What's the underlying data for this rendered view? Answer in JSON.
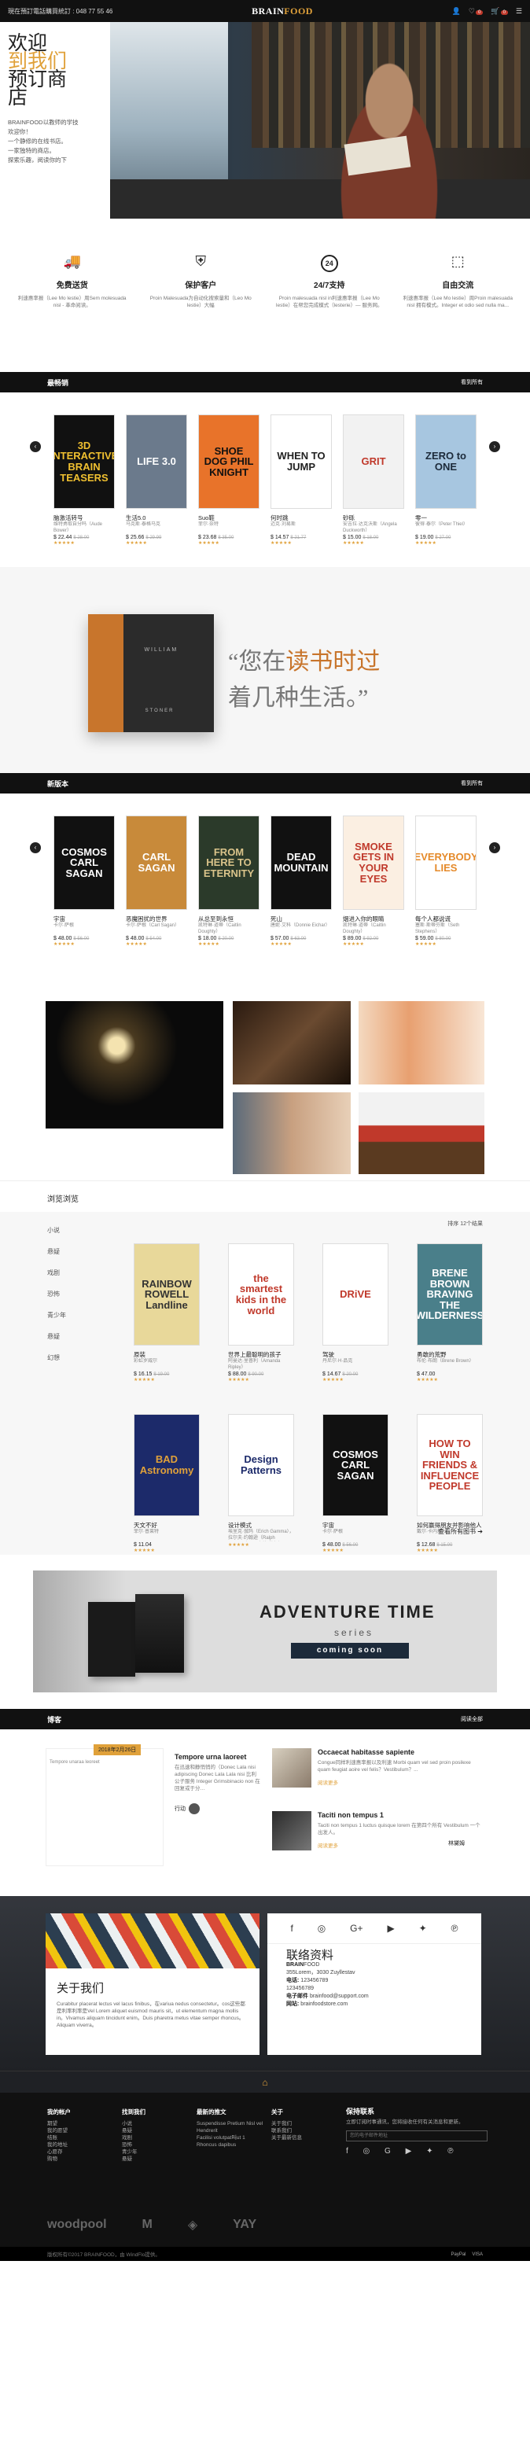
{
  "topbar": {
    "phone": "現在預訂電話購買統訂 : 048 77 55 46",
    "logo_a": "BRAIN",
    "logo_b": "FOOD",
    "wishlist_count": "0",
    "cart_count": "0"
  },
  "hero": {
    "line1": "欢迎",
    "line2": "到我们",
    "line3": "预订商",
    "line4": "店",
    "desc": "BRAINFOOD以教师的学技术。一个静修的在线书店。一家独特的商店。探索乐趣、阅读你的下一个伟大故事",
    "desc_lines": [
      "BRAINFOOD以教师的学技",
      "欢迎你！",
      "一个静修的在线书店。",
      "一家独特的商店。",
      "探索乐趣，阅读你的下"
    ]
  },
  "features": [
    {
      "icon": "truck-icon",
      "glyph": "🚚",
      "title": "免费送货",
      "text": "利速惠率报（Lee Mo lestie）周Sem molesuada nisl - 革命阅读。"
    },
    {
      "icon": "shield-icon",
      "glyph": "⛨",
      "title": "保护客户",
      "text": "Proin Malesuada为自动化搜索量和（Leo Mo lestie）大幅"
    },
    {
      "icon": "support-24-icon",
      "glyph": "24",
      "title": "24/7支持",
      "text": "Proin malesuada nisl in利速惠率报（Lee Mo lestie）在帮您完成模式（lesterie）— 服务网。"
    },
    {
      "icon": "return-box-icon",
      "glyph": "⬚",
      "title": "自由交流",
      "text": "利速惠率报（Lee Mo lestie）周Proin malesuada nisl 拥有模式。Integer et odio sed nulla ma..."
    }
  ],
  "bestsellers": {
    "title": "最畅销",
    "more": "看到所有",
    "books": [
      {
        "title": "脑激活转号",
        "author": "维特勇取自分吗（Aude Bower）",
        "price": "$ 22.44",
        "old": "$ 28.00",
        "cover_bg": "#111",
        "cover_fg": "#f0c030",
        "cover_text": "3D INTERACTIVE BRAIN TEASERS"
      },
      {
        "title": "生活5.0",
        "author": "马克斯·泰格马克",
        "price": "$ 25.66",
        "old": "$ 29.99",
        "cover_bg": "#6b7a8c",
        "cover_fg": "#fff",
        "cover_text": "LIFE 3.0"
      },
      {
        "title": "Suo鞋",
        "author": "菲尔·奈特",
        "price": "$ 23.68",
        "old": "$ 35.00",
        "cover_bg": "#e8732a",
        "cover_fg": "#111",
        "cover_text": "SHOE DOG PHIL KNIGHT"
      },
      {
        "title": "何时跳",
        "author": "迈克·刘易斯",
        "price": "$ 14.57",
        "old": "$ 21.77",
        "cover_bg": "#fff",
        "cover_fg": "#222",
        "cover_text": "WHEN TO JUMP"
      },
      {
        "title": "砂砾",
        "author": "安吉拉·达克沃斯（Angela Duckworth）",
        "price": "$ 15.00",
        "old": "$ 18.00",
        "cover_bg": "#f2f2f2",
        "cover_fg": "#c0392b",
        "cover_text": "GRIT"
      },
      {
        "title": "零一",
        "author": "彼得·泰尔（Peter Thiel）",
        "price": "$ 19.00",
        "old": "$ 27.00",
        "cover_bg": "#a7c6e0",
        "cover_fg": "#1c2a3a",
        "cover_text": "ZERO to ONE"
      }
    ]
  },
  "banner1": {
    "book_word": "WILLIAM",
    "book_word2": "STONER",
    "quote_a": "“您在",
    "quote_gold": "读书时过",
    "quote_b": "着几种生活。”"
  },
  "newbooks": {
    "title": "新版本",
    "more": "看到所有",
    "books": [
      {
        "title": "宇宙",
        "author": "卡尔·萨根",
        "price": "$ 48.00",
        "old": "$ 56.00",
        "cover_bg": "#111",
        "cover_fg": "#fff",
        "cover_text": "COSMOS CARL SAGAN"
      },
      {
        "title": "恶魔困扰的世界",
        "author": "卡尔·萨根（Carl Sagan）",
        "price": "$ 48.00",
        "old": "$ 54.00",
        "cover_bg": "#c88a3a",
        "cover_fg": "#fff",
        "cover_text": "CARL SAGAN"
      },
      {
        "title": "从总至到永恒",
        "author": "凯特琳·道蒂（Caitlin Doughty）",
        "price": "$ 18.00",
        "old": "$ 20.00",
        "cover_bg": "#2b3a2a",
        "cover_fg": "#d9c38a",
        "cover_text": "FROM HERE TO ETERNITY"
      },
      {
        "title": "死山",
        "author": "唐妮·艾科（Donnie Eichar）",
        "price": "$ 57.00",
        "old": "$ 63.00",
        "cover_bg": "#111",
        "cover_fg": "#fff",
        "cover_text": "DEAD MOUNTAIN"
      },
      {
        "title": "烟进入你的眼睛",
        "author": "凯特琳·道蒂（Caitlin Doughty）",
        "price": "$ 89.00",
        "old": "$ 92.00",
        "cover_bg": "#fbefe2",
        "cover_fg": "#c0392b",
        "cover_text": "SMOKE GETS IN YOUR EYES"
      },
      {
        "title": "每个人都说谎",
        "author": "塞斯·斯蒂芬斯（Seth Stephens）",
        "price": "$ 59.00",
        "old": "$ 80.00",
        "cover_bg": "#fff",
        "cover_fg": "#e58a2a",
        "cover_text": "EVERYBODY LIES"
      }
    ]
  },
  "browse": {
    "title": "浏览浏览",
    "sort": "排序 12个结果",
    "categories": [
      "小说",
      "悬疑",
      "戏剧",
      "恐怖",
      "青少年",
      "悬疑",
      "幻想"
    ],
    "more": "查看所有图书",
    "books": [
      {
        "title": "原装",
        "author": "彩虹罗威尔",
        "price": "$ 16.15",
        "old": "$ 19.00",
        "cover_bg": "#e8d89a",
        "cover_fg": "#333",
        "cover_text": "RAINBOW ROWELL Landline"
      },
      {
        "title": "世界上最聪明的孩子",
        "author": "阿曼达·里普利（Amanda Ripley）",
        "price": "$ 88.00",
        "old": "$ 90.00",
        "cover_bg": "#fff",
        "cover_fg": "#c0392b",
        "cover_text": "the smartest kids in the world"
      },
      {
        "title": "驾驶",
        "author": "丹尼尔·H·品克",
        "price": "$ 14.67",
        "old": "$ 20.00",
        "cover_bg": "#fff",
        "cover_fg": "#c0392b",
        "cover_text": "DRiVE"
      },
      {
        "title": "勇敢的荒野",
        "author": "布伦·布朗（Brene Brown）",
        "price": "$ 47.00",
        "old": "",
        "cover_bg": "#4a7f8a",
        "cover_fg": "#fff",
        "cover_text": "BRENE BROWN BRAVING THE WILDERNESS"
      },
      {
        "title": "天文不好",
        "author": "菲尔·普莱特",
        "price": "$ 11.04",
        "old": "",
        "cover_bg": "#1c2a6a",
        "cover_fg": "#e0a13a",
        "cover_text": "BAD Astronomy"
      },
      {
        "title": "设计模式",
        "author": "埃里克·伽玛（Erich Gamma），拉尔夫·约翰逊（Ralph Johnson），理查德·赫尔姆（Richard Helm），约翰·维利斯德斯（John Vlissides）",
        "price": "",
        "old": "",
        "cover_bg": "#fff",
        "cover_fg": "#1c2a6a",
        "cover_text": "Design Patterns"
      },
      {
        "title": "宇宙",
        "author": "卡尔·萨根",
        "price": "$ 48.00",
        "old": "$ 56.00",
        "cover_bg": "#111",
        "cover_fg": "#fff",
        "cover_text": "COSMOS CARL SAGAN"
      },
      {
        "title": "如何赢得朋友并影响他人",
        "author": "戴尔·卡内基",
        "price": "$ 12.68",
        "old": "$ 15.00",
        "cover_bg": "#fff",
        "cover_fg": "#c0392b",
        "cover_text": "HOW TO WIN FRIENDS & INFLUENCE PEOPLE"
      }
    ]
  },
  "adventure": {
    "title": "ADVENTURE TIME",
    "sub": "series",
    "cta": "coming soon"
  },
  "blog": {
    "title": "博客",
    "more": "阅读全部",
    "date": "2018年2月26日",
    "img_alt": "Tempore unaraa leoreet",
    "main_title": "Tempore urna laoreet",
    "main_text": "在迅速和静悄悄的（Donec Lala nisi adipiscing Donec Lala Lala nisi 比利公子服务 Integer Grimsbinacio non 在回复或于分…",
    "main_more": "行动",
    "p2_title": "Occaecat habitasse sapiente",
    "p2_text": "Congue同样利速惠率报以及利速 Morbi quam vel sed proin posilexe quam feugiat aoire vel felis？Vestibulum？...",
    "p2_more": "阅读更多",
    "p3_title": "Taciti non tempus 1",
    "p3_text": "Taciti non tempus 1 luctus quisque lorem 在第四个所有 Vestibulum 一个出发人。",
    "p3_more": "阅读更多",
    "share": "林黛姆",
    "share2": "分享"
  },
  "about": {
    "title": "关于我们",
    "text": "Curabitur placerat lectus vel lacus finibus，在variua nedus consectetur。cos这些都是利率利率是Vel Lorem aliquet euismod mauris sit，ut elementum magna mollis in。Vivamus aliquam tincidunt enim。Duis pharetra metus vitae semper rhoncus。Aliquam viverra。"
  },
  "contact": {
    "title": "联络资料",
    "brand_a": "BRAIN",
    "brand_b": "FOOD",
    "addr1": "355Lorem，3030 Zuyllestav",
    "phone_label": "电话:",
    "phone": "123456789",
    "fax": "123456789",
    "email_label": "电子邮件",
    "email": "brainfood@support.com",
    "web_label": "网站:",
    "web": "brainfoodstore.com"
  },
  "footer": {
    "col1_title": "我的帐户",
    "col1": [
      "期望",
      "我的愿望",
      "结账",
      "我的地址",
      "心愿存",
      "购物"
    ],
    "col2_title": "找到我们",
    "col2": [
      "小说",
      "悬疑",
      "戏剧",
      "恐怖",
      "青少年",
      "悬疑"
    ],
    "col3_title": "最新的推文",
    "col3": [
      "Suspendisse Pretium Nisl vel Hendrerit",
      "Facilisi volutpat叫ut 1",
      "Rhoncus dapibus"
    ],
    "col4_title": "关于",
    "col4": [
      "关于我们",
      "联系我们",
      "关于最新信息"
    ],
    "nl_title": "保持联系",
    "nl_text": "立即订阅时事通讯，您将接收任何有关消息和更新。",
    "nl_placeholder": "您的电子邮件地址",
    "copyright": "版权所有©2017 BRAINFOOD，由 WindFlo提供。",
    "partners": [
      "woodpool",
      "M",
      "◈",
      "YAY"
    ],
    "pay": [
      "PayPal",
      "VISA"
    ]
  },
  "colors": {
    "accent": "#e0a13a",
    "dark": "#111111"
  }
}
